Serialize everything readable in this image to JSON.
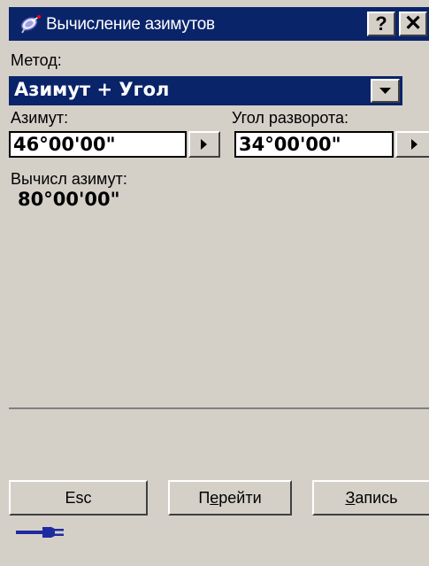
{
  "window": {
    "title": "Вычисление азимутов",
    "help_label": "?",
    "close_label": "✕"
  },
  "method": {
    "label": "Метод:",
    "value": "Азимут + Угол"
  },
  "azimuth": {
    "label": "Азимут:",
    "value": "46°00'00\""
  },
  "turn_angle": {
    "label": "Угол разворота:",
    "value": "34°00'00\""
  },
  "computed": {
    "label": "Вычисл азимут:",
    "value": "80°00'00\""
  },
  "buttons": {
    "esc": "Esc",
    "go_pre": "П",
    "go_underline": "е",
    "go_post": "рейти",
    "record_underline": "З",
    "record_post": "апись"
  },
  "icons": {
    "app": "satellite-dish-icon",
    "status": "power-plug-icon"
  },
  "colors": {
    "titlebar": "#0a246a",
    "selection": "#0a246a",
    "face": "#d4d0c8",
    "plug": "#1e2aa0"
  }
}
